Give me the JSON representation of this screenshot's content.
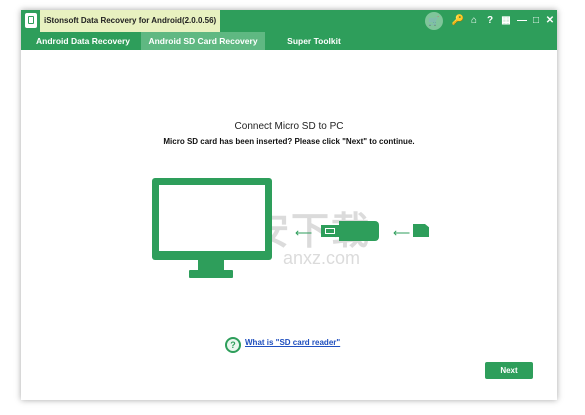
{
  "app": {
    "title": "iStonsoft Data Recovery for Android(2.0.0.56)"
  },
  "controls": {
    "cart": "🛒",
    "key": "🔑",
    "home": "⌂",
    "help": "?",
    "register": "▦",
    "minimize": "—",
    "maximize": "□",
    "close": "✕"
  },
  "tabs": [
    {
      "label": "Android Data Recovery",
      "active": false
    },
    {
      "label": "Android SD Card Recovery",
      "active": true
    },
    {
      "label": "Super Toolkit",
      "active": false
    }
  ],
  "main": {
    "heading": "Connect Micro SD to PC",
    "subheading": "Micro SD card has been inserted? Please click \"Next\" to continue."
  },
  "help": {
    "icon": "?",
    "link_text": "What is \"SD card reader\""
  },
  "footer": {
    "next_label": "Next"
  },
  "watermark": {
    "cn_text": "安下载",
    "en_text": "anxz.com",
    "shield_char": "安"
  },
  "colors": {
    "accent": "#2e9e5b",
    "active_tab": "#5fb882",
    "link": "#1f4fbf"
  }
}
